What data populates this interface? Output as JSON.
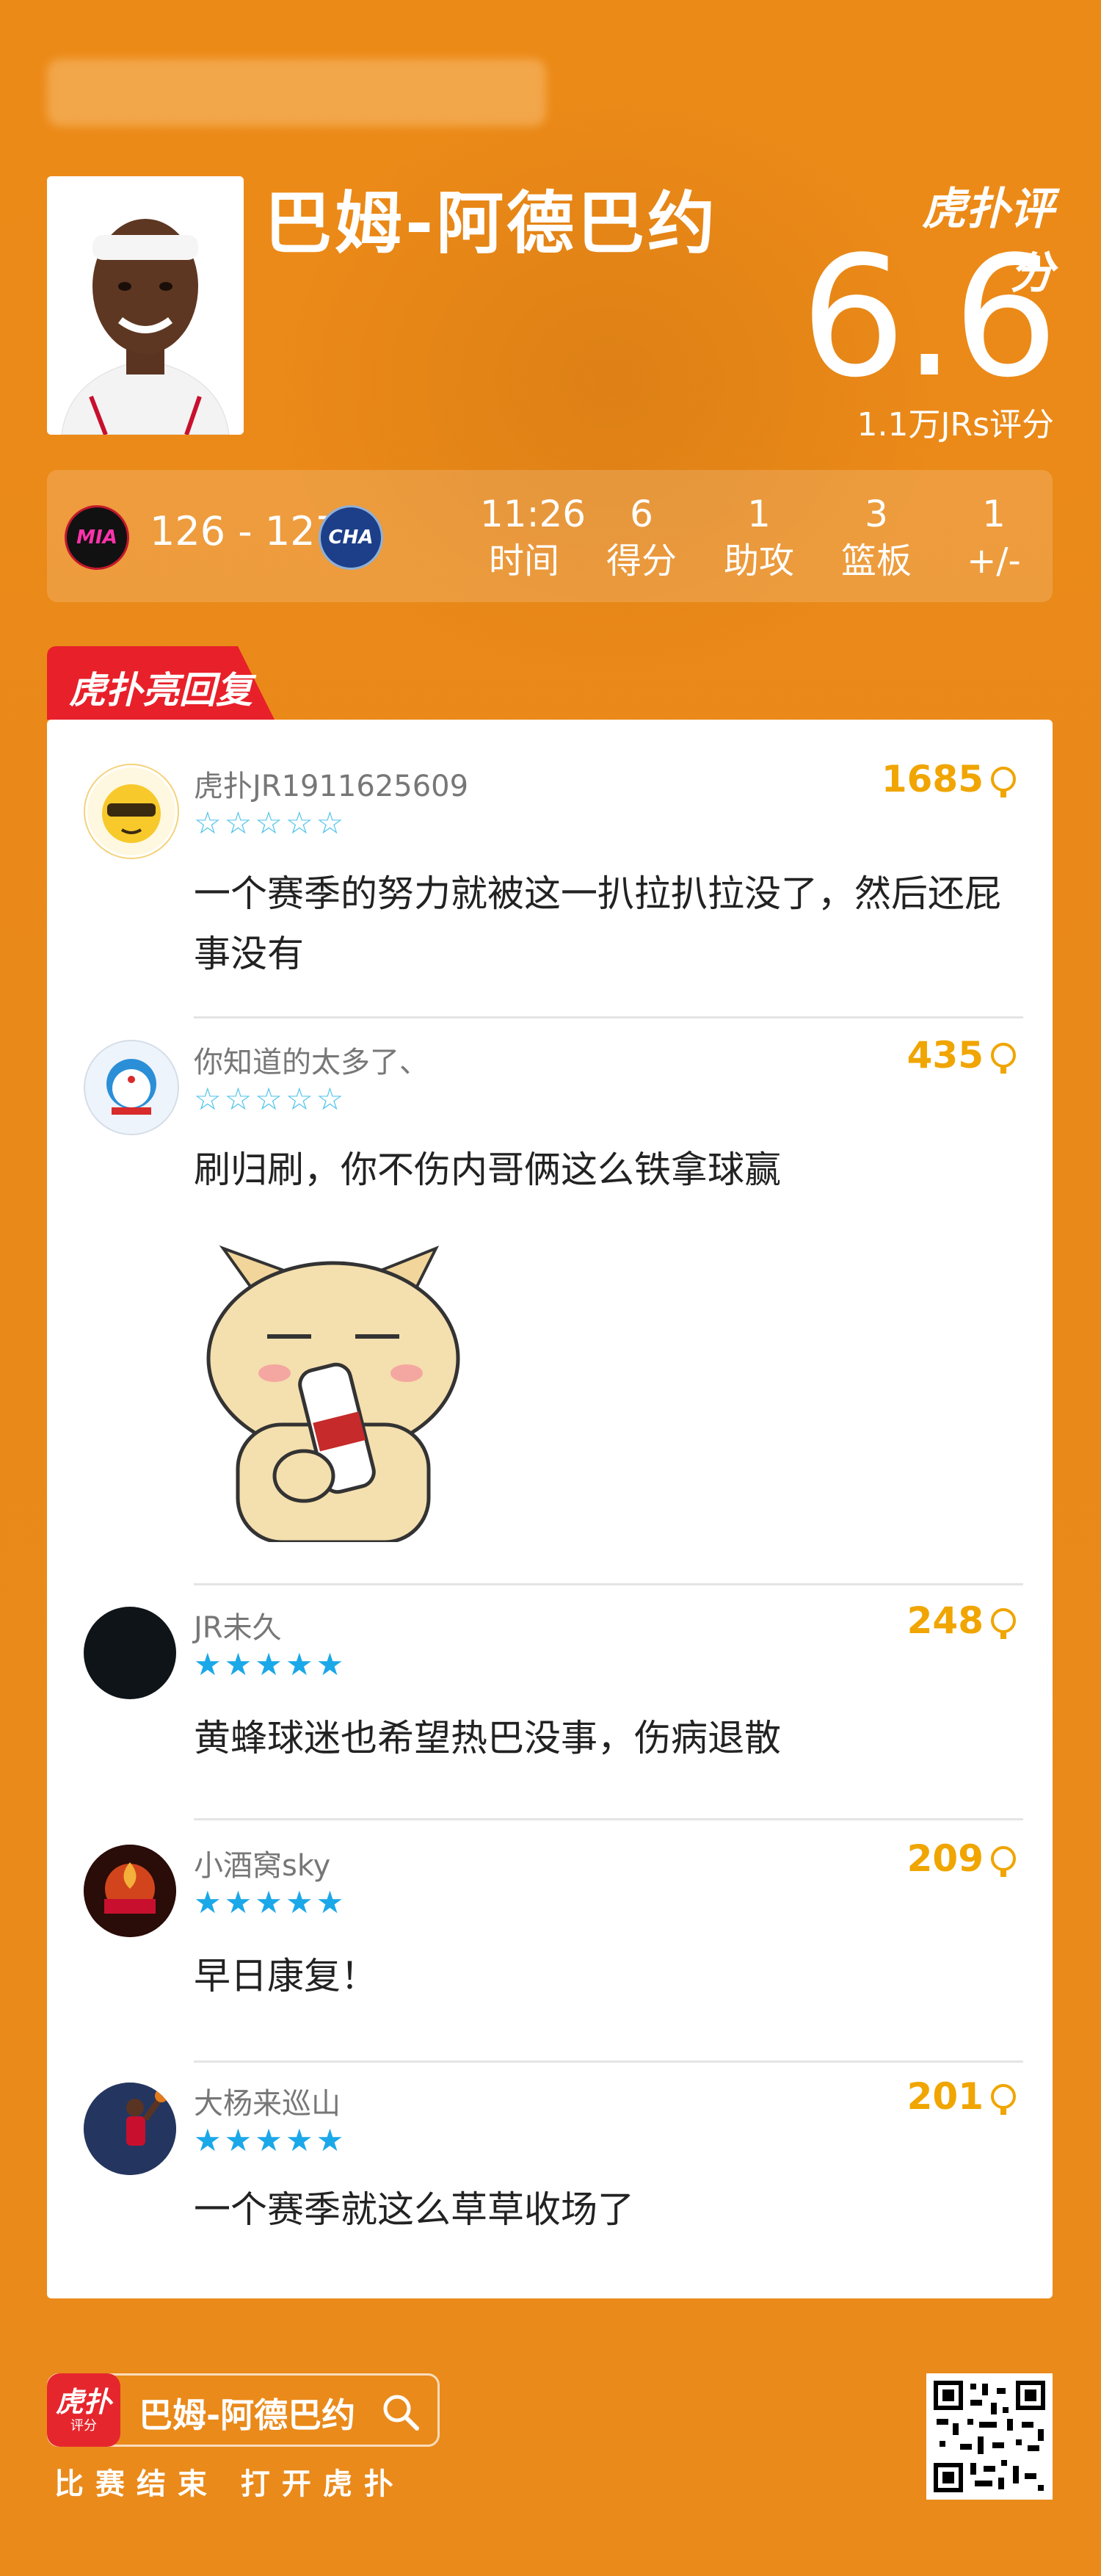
{
  "player": {
    "name": "巴姆-阿德巴约"
  },
  "rating": {
    "brand_label": "虎扑评分",
    "score": "6.6",
    "count_label": "1.1万JRs评分"
  },
  "game": {
    "home_team": "MIA",
    "away_team": "CHA",
    "score": "126 - 127",
    "stats": [
      {
        "value": "11:26",
        "label": "时间"
      },
      {
        "value": "6",
        "label": "得分"
      },
      {
        "value": "1",
        "label": "助攻"
      },
      {
        "value": "3",
        "label": "篮板"
      },
      {
        "value": "1",
        "label": "+/-"
      }
    ]
  },
  "section_badge": "虎扑亮回复",
  "comments": [
    {
      "user": "虎扑JR1911625609",
      "likes": "1685",
      "stars_filled": 0,
      "text": "一个赛季的努力就被这一扒拉扒拉没了，然后还屁事没有",
      "avatar_icon": "sunglasses-cat-avatar"
    },
    {
      "user": "你知道的太多了、",
      "likes": "435",
      "stars_filled": 0,
      "text": "刷归刷，你不伤内哥俩这么铁拿球赢",
      "avatar_icon": "doraemon-avatar",
      "image_icon": "shiba-dog-drinking-sticker"
    },
    {
      "user": "JR未久",
      "likes": "248",
      "stars_filled": 5,
      "text": "黄蜂球迷也希望热巴没事，伤病退散",
      "avatar_icon": "dark-avatar"
    },
    {
      "user": "小酒窝sky",
      "likes": "209",
      "stars_filled": 5,
      "text": "早日康复！",
      "avatar_icon": "heat-logo-avatar"
    },
    {
      "user": "大杨来巡山",
      "likes": "201",
      "stars_filled": 5,
      "text": "一个赛季就这么草草收场了",
      "avatar_icon": "basketball-player-avatar"
    }
  ],
  "footer": {
    "app_badge": "虎扑",
    "app_badge_sub": "评分",
    "search_text": "巴姆-阿德巴约",
    "caption": "比赛结束 打开虎扑"
  }
}
